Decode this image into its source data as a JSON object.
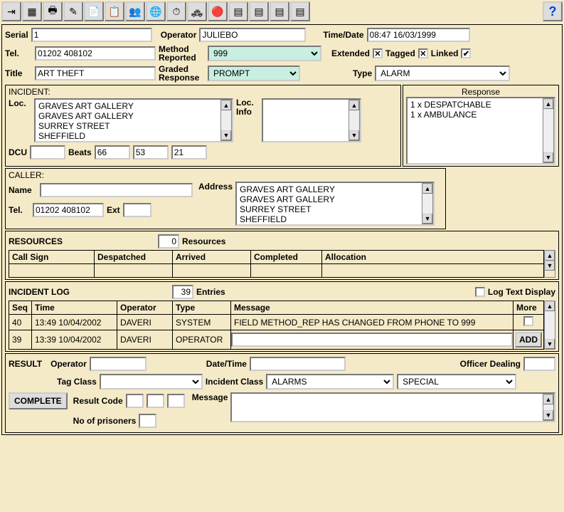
{
  "toolbar_icons": [
    "exit-icon",
    "form-icon",
    "printer-icon",
    "edit-icon",
    "notes-icon",
    "dispatch-icon",
    "people-icon",
    "map-icon",
    "timer-icon",
    "car-icon",
    "record-icon",
    "list1-icon",
    "list2-icon",
    "list3-icon",
    "list4-icon"
  ],
  "help": "?",
  "row1": {
    "serial_label": "Serial",
    "serial": "1",
    "operator_label": "Operator",
    "operator": "JULIEBO",
    "timedate_label": "Time/Date",
    "timedate": "08:47 16/03/1999"
  },
  "row2": {
    "tel_label": "Tel.",
    "tel": "01202 408102",
    "method_label": "Method Reported",
    "method": "999",
    "extended_label": "Extended",
    "extended": "✕",
    "tagged_label": "Tagged",
    "tagged": "✕",
    "linked_label": "Linked",
    "linked": "✔"
  },
  "row3": {
    "title_label": "Title",
    "title": "ART THEFT",
    "graded_label": "Graded Response",
    "graded": "PROMPT",
    "type_label": "Type",
    "type": "ALARM"
  },
  "incident": {
    "header": "INCIDENT:",
    "loc_label": "Loc.",
    "loc_lines": "GRAVES ART GALLERY\nGRAVES ART GALLERY\nSURREY STREET\nSHEFFIELD",
    "locinfo_label": "Loc. Info",
    "dcu_label": "DCU",
    "dcu": "",
    "beats_label": "Beats",
    "beats": [
      "66",
      "53",
      "21"
    ]
  },
  "response": {
    "header": "Response",
    "lines": "1 x DESPATCHABLE\n1 x AMBULANCE"
  },
  "caller": {
    "header": "CALLER:",
    "name_label": "Name",
    "name": "",
    "address_label": "Address",
    "address_lines": "GRAVES ART GALLERY\nGRAVES ART GALLERY\nSURREY STREET\nSHEFFIELD",
    "tel_label": "Tel.",
    "tel": "01202 408102",
    "ext_label": "Ext",
    "ext": ""
  },
  "resources": {
    "header": "RESOURCES",
    "count": "0",
    "count_label": "Resources",
    "cols": [
      "Call Sign",
      "Despatched",
      "Arrived",
      "Completed",
      "Allocation"
    ]
  },
  "log": {
    "header": "INCIDENT LOG",
    "entries_count": "39",
    "entries_label": "Entries",
    "logtext_label": "Log Text Display",
    "cols": [
      "Seq",
      "Time",
      "Operator",
      "Type",
      "Message",
      "More"
    ],
    "rows": [
      {
        "seq": "40",
        "time": "13:49 10/04/2002",
        "op": "DAVERI",
        "type": "SYSTEM",
        "msg": "FIELD METHOD_REP HAS CHANGED FROM PHONE TO 999",
        "more": ""
      },
      {
        "seq": "39",
        "time": "13:39 10/04/2002",
        "op": "DAVERI",
        "type": "OPERATOR",
        "msg": "",
        "more": ""
      }
    ],
    "add_btn": "ADD"
  },
  "result": {
    "header": "RESULT",
    "operator_label": "Operator",
    "datetime_label": "Date/Time",
    "officer_label": "Officer Dealing",
    "tagclass_label": "Tag Class",
    "incidentclass_label": "Incident Class",
    "incidentclass": "ALARMS",
    "special": "SPECIAL",
    "complete_btn": "COMPLETE",
    "resultcode_label": "Result Code",
    "message_label": "Message",
    "prisoners_label": "No of prisoners"
  }
}
